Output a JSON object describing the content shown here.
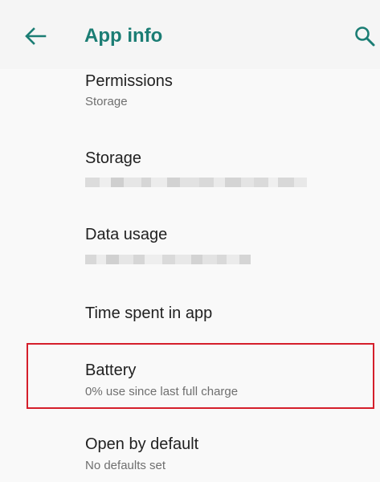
{
  "header": {
    "title": "App info",
    "back_icon": "arrow-back-icon",
    "search_icon": "search-icon"
  },
  "colors": {
    "accent": "#1b7d74",
    "highlight": "#d51f2b",
    "primary_text": "#212121",
    "secondary_text": "#6f6f6f"
  },
  "items": [
    {
      "title": "Permissions",
      "subtitle": "Storage"
    },
    {
      "title": "Storage",
      "subtitle_redacted": true
    },
    {
      "title": "Data usage",
      "subtitle_redacted": true
    },
    {
      "title": "Time spent in app"
    },
    {
      "title": "Battery",
      "subtitle": "0% use since last full charge",
      "highlighted": true
    },
    {
      "title": "Open by default",
      "subtitle": "No defaults set"
    }
  ]
}
